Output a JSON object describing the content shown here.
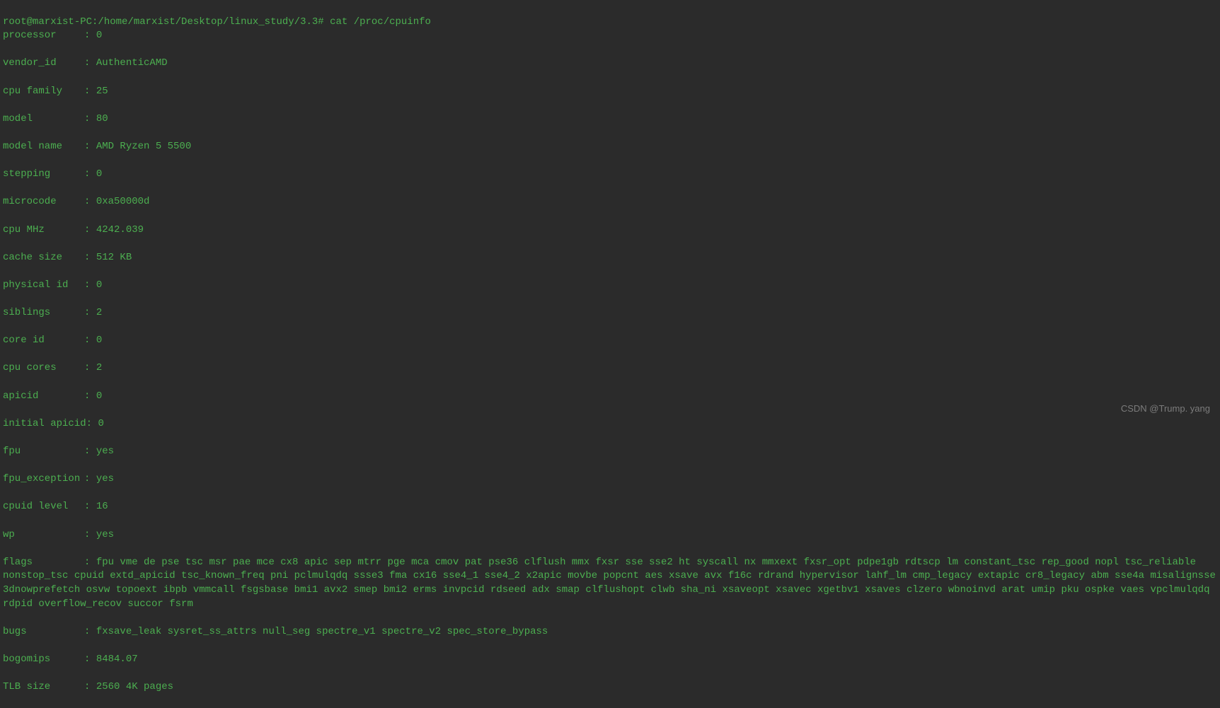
{
  "prompt": {
    "user_host": "root@marxist-PC",
    "path": ":/home/marxist/Desktop/linux_study/3.3#",
    "command": "cat /proc/cpuinfo"
  },
  "cpuinfo": {
    "processor": {
      "key": "processor",
      "value": "0"
    },
    "vendor_id": {
      "key": "vendor_id",
      "value": "AuthenticAMD"
    },
    "cpu_family": {
      "key": "cpu family",
      "value": "25"
    },
    "model": {
      "key": "model",
      "value": "80"
    },
    "model_name": {
      "key": "model name",
      "value": "AMD Ryzen 5 5500"
    },
    "stepping": {
      "key": "stepping",
      "value": "0"
    },
    "microcode": {
      "key": "microcode",
      "value": "0xa50000d"
    },
    "cpu_mhz": {
      "key": "cpu MHz",
      "value": "4242.039"
    },
    "cache_size": {
      "key": "cache size",
      "value": "512 KB"
    },
    "physical_id": {
      "key": "physical id",
      "value": "0"
    },
    "siblings": {
      "key": "siblings",
      "value": "2"
    },
    "core_id": {
      "key": "core id",
      "value": "0"
    },
    "cpu_cores": {
      "key": "cpu cores",
      "value": "2"
    },
    "apicid": {
      "key": "apicid",
      "value": "0"
    },
    "initial_apicid": {
      "key": "initial apicid",
      "value": "0"
    },
    "fpu": {
      "key": "fpu",
      "value": "yes"
    },
    "fpu_exception": {
      "key": "fpu_exception",
      "value": "yes"
    },
    "cpuid_level": {
      "key": "cpuid level",
      "value": "16"
    },
    "wp": {
      "key": "wp",
      "value": "yes"
    },
    "flags": {
      "key": "flags",
      "value": "fpu vme de pse tsc msr pae mce cx8 apic sep mtrr pge mca cmov pat pse36 clflush mmx fxsr sse sse2 ht syscall nx mmxext fxsr_opt pdpe1gb rdtscp lm constant_tsc rep_good nopl tsc_reliable nonstop_tsc cpuid extd_apicid tsc_known_freq pni pclmulqdq ssse3 fma cx16 sse4_1 sse4_2 x2apic movbe popcnt aes xsave avx f16c rdrand hypervisor lahf_lm cmp_legacy extapic cr8_legacy abm sse4a misalignsse 3dnowprefetch osvw topoext ibpb vmmcall fsgsbase bmi1 avx2 smep bmi2 erms invpcid rdseed adx smap clflushopt clwb sha_ni xsaveopt xsavec xgetbv1 xsaves clzero wbnoinvd arat umip pku ospke vaes vpclmulqdq rdpid overflow_recov succor fsrm"
    },
    "bugs": {
      "key": "bugs",
      "value": "fxsave_leak sysret_ss_attrs null_seg spectre_v1 spectre_v2 spec_store_bypass"
    },
    "bogomips": {
      "key": "bogomips",
      "value": "8484.07"
    },
    "tlb_size": {
      "key": "TLB size",
      "value": "2560 4K pages"
    }
  },
  "watermark": "CSDN @Trump. yang"
}
